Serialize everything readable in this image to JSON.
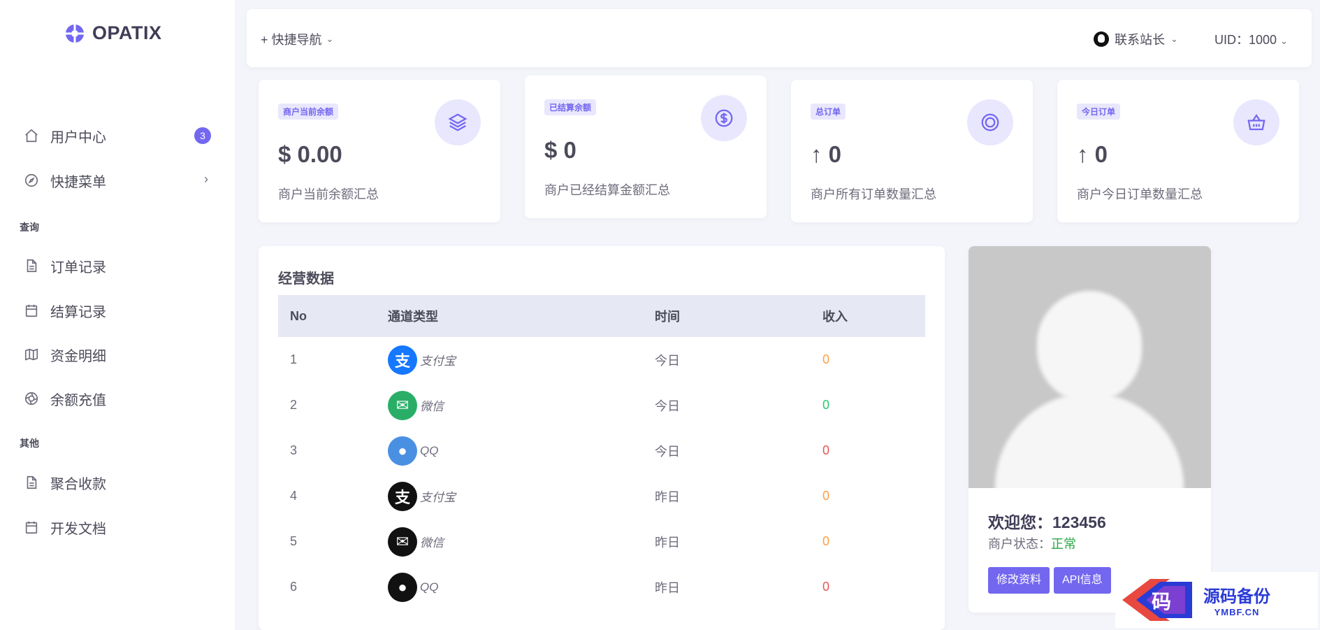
{
  "brand": {
    "name": "OPATIX"
  },
  "sidebar": {
    "items": [
      {
        "label": "用户中心",
        "badge": "3"
      },
      {
        "label": "快捷菜单"
      }
    ],
    "sections": [
      {
        "title": "查询",
        "items": [
          {
            "label": "订单记录"
          },
          {
            "label": "结算记录"
          },
          {
            "label": "资金明细"
          },
          {
            "label": "余额充值"
          }
        ]
      },
      {
        "title": "其他",
        "items": [
          {
            "label": "聚合收款"
          },
          {
            "label": "开发文档"
          }
        ]
      }
    ]
  },
  "topbar": {
    "quick_nav": "+ 快捷导航",
    "contact": "联系站长",
    "uid": "UID：1000"
  },
  "stats": [
    {
      "badge": "商户当前余额",
      "value": "$ 0.00",
      "desc": "商户当前余额汇总"
    },
    {
      "badge": "已结算余额",
      "value": "$ 0",
      "desc": "商户已经结算金额汇总"
    },
    {
      "badge": "总订单",
      "value": "0",
      "desc": "商户所有订单数量汇总"
    },
    {
      "badge": "今日订单",
      "value": "0",
      "desc": "商户今日订单数量汇总"
    }
  ],
  "business": {
    "title": "经营数据",
    "columns": [
      "No",
      "通道类型",
      "时间",
      "收入"
    ],
    "rows": [
      {
        "no": "1",
        "channel": "支付宝",
        "time": "今日",
        "income": "0"
      },
      {
        "no": "2",
        "channel": "微信",
        "time": "今日",
        "income": "0"
      },
      {
        "no": "3",
        "channel": "QQ",
        "time": "今日",
        "income": "0"
      },
      {
        "no": "4",
        "channel": "支付宝",
        "time": "昨日",
        "income": "0"
      },
      {
        "no": "5",
        "channel": "微信",
        "time": "昨日",
        "income": "0"
      },
      {
        "no": "6",
        "channel": "QQ",
        "time": "昨日",
        "income": "0"
      }
    ]
  },
  "profile": {
    "welcome_label": "欢迎您：",
    "username": "123456",
    "status_label": "商户状态：",
    "status_value": "正常",
    "edit_button": "修改资料",
    "api_button": "API信息"
  },
  "watermark": {
    "cn": "源码备份",
    "en": "YMBF.CN",
    "mark": "码"
  },
  "colors": {
    "accent": "#7367f0",
    "accent_light": "#e9e7fd",
    "alipay": "#1677ff",
    "wechat": "#2aae67",
    "qq": "#4a90e2"
  }
}
